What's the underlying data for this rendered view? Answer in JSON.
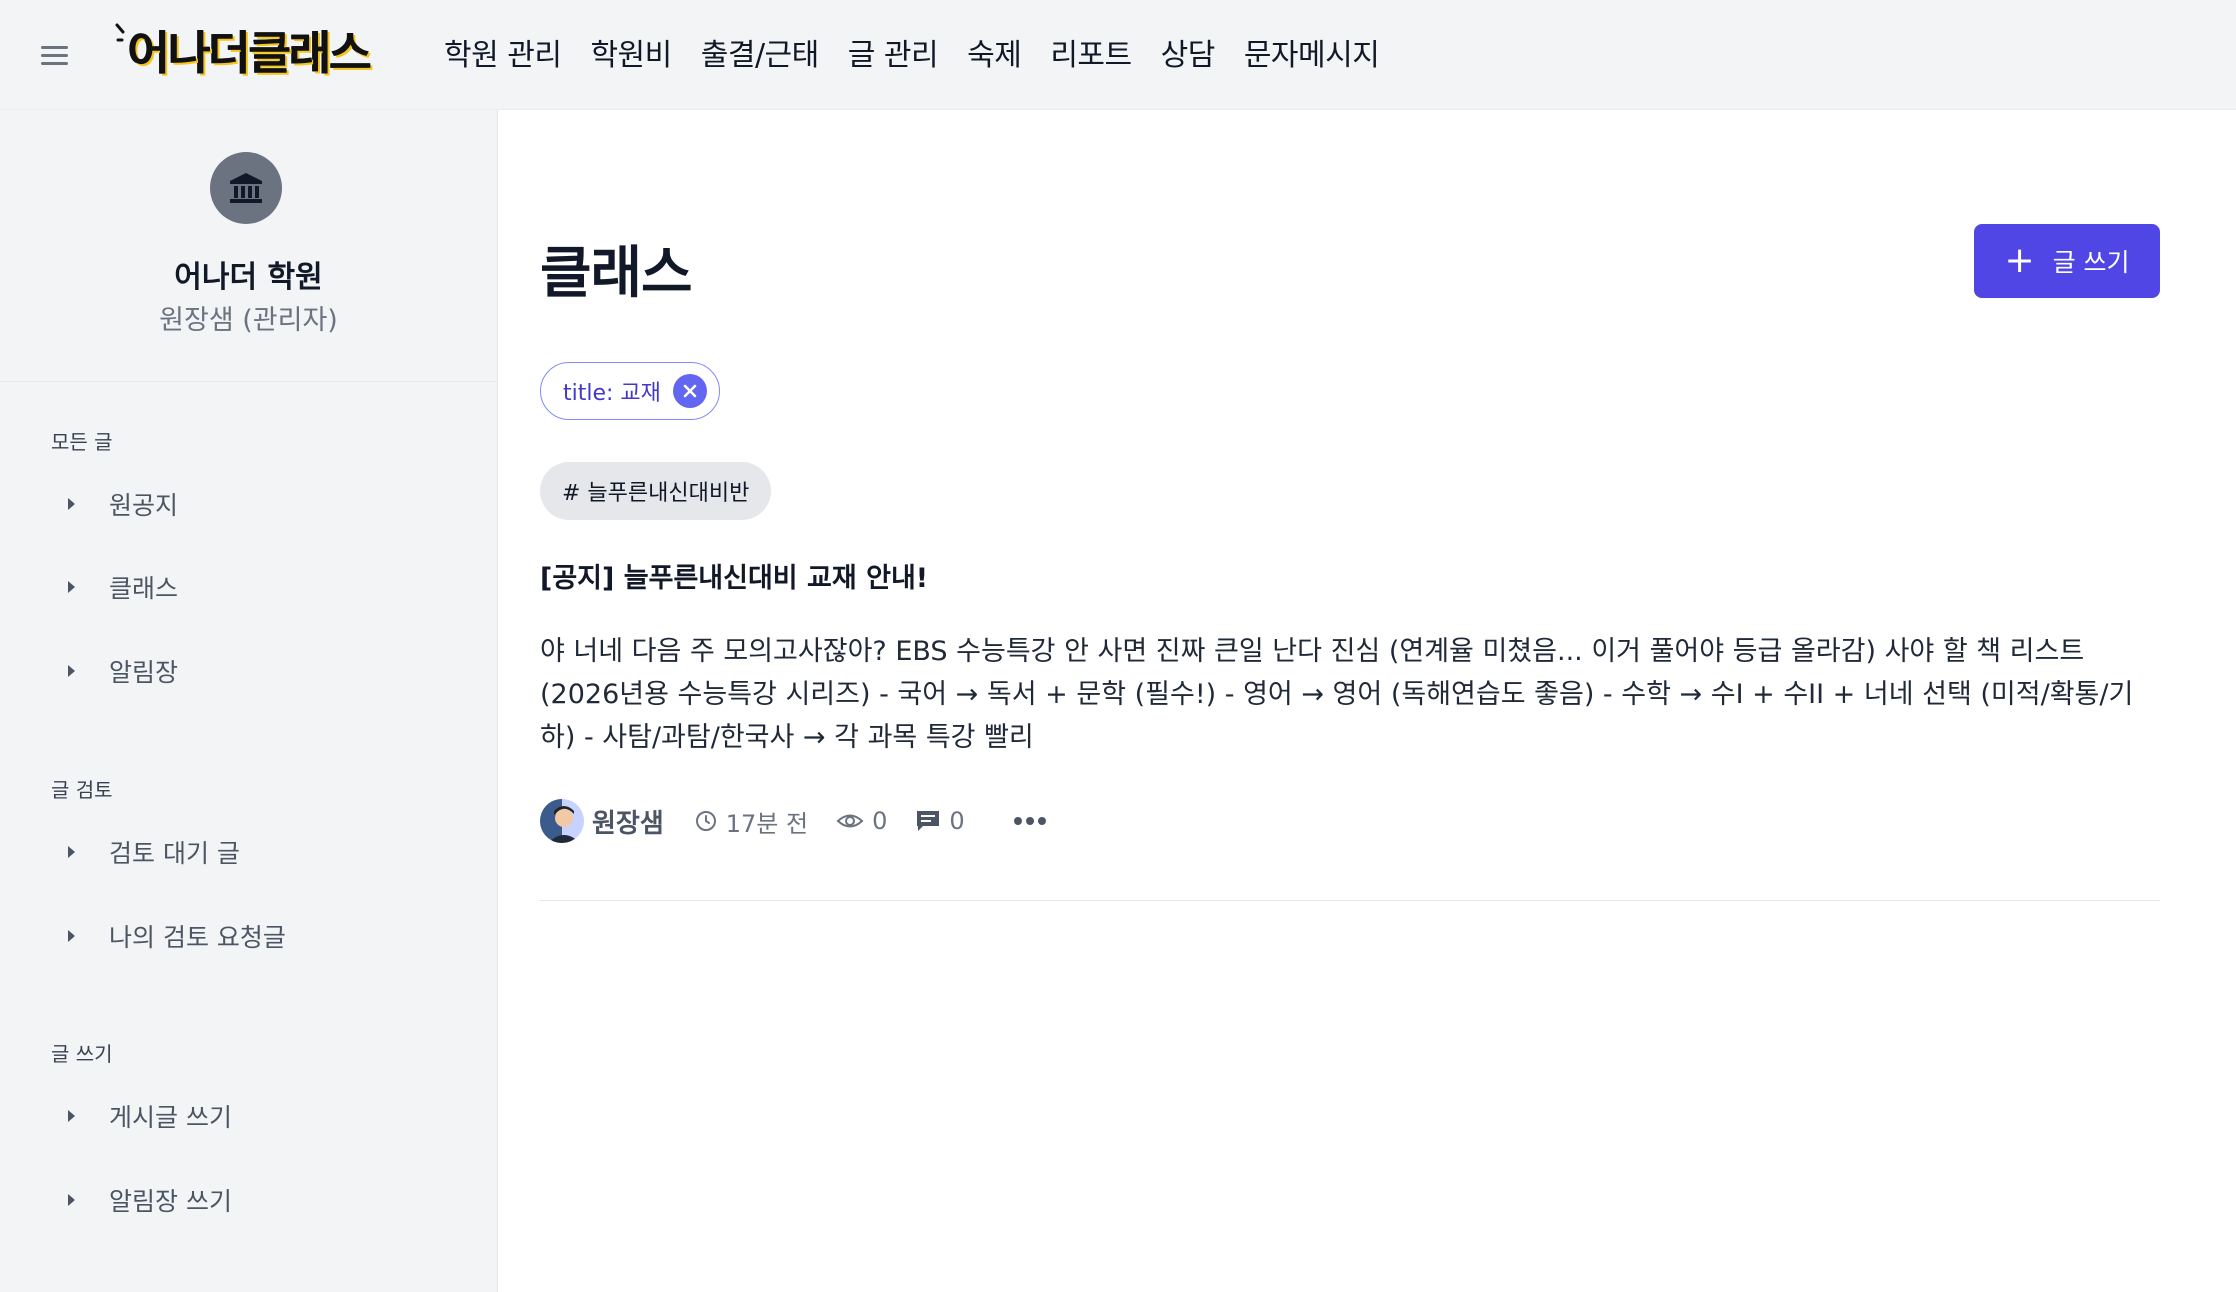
{
  "header": {
    "logo_text": "어나더클래스",
    "nav": [
      "학원 관리",
      "학원비",
      "출결/근태",
      "글 관리",
      "숙제",
      "리포트",
      "상담",
      "문자메시지"
    ]
  },
  "sidebar": {
    "org_name": "어나더 학원",
    "org_role": "원장샘 (관리자)",
    "sections": [
      {
        "title": "모든 글",
        "items": [
          "원공지",
          "클래스",
          "알림장"
        ]
      },
      {
        "title": "글 검토",
        "items": [
          "검토 대기 글",
          "나의 검토 요청글"
        ]
      },
      {
        "title": "글 쓰기",
        "items": [
          "게시글 쓰기",
          "알림장 쓰기"
        ]
      }
    ]
  },
  "main": {
    "title": "클래스",
    "write_button": "글 쓰기",
    "filter_chip": "title: 교재",
    "tag": "# 늘푸른내신대비반",
    "post": {
      "title": "[공지] 늘푸른내신대비 교재 안내!",
      "body": "야 너네 다음 주 모의고사잖아? EBS 수능특강 안 사면 진짜 큰일 난다 진심 (연계율 미쳤음... 이거 풀어야 등급 올라감) 사야 할 책 리스트 (2026년용 수능특강 시리즈) - 국어 → 독서 + 문학 (필수!) - 영어 → 영어 (독해연습도 좋음) - 수학 → 수I + 수II + 너네 선택 (미적/확통/기하) - 사탐/과탐/한국사 → 각 과목 특강 빨리",
      "author": "원장샘",
      "time": "17분 전",
      "views": "0",
      "comments": "0"
    }
  },
  "colors": {
    "primary": "#4f46e5",
    "sidebar_bg": "#f3f4f6",
    "chip_border": "#818cf8"
  }
}
